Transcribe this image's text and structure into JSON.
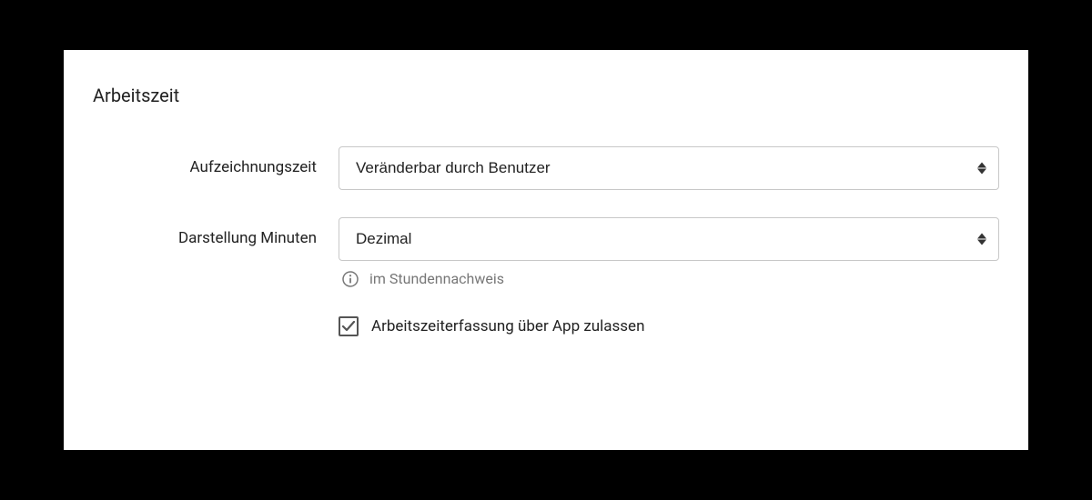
{
  "section": {
    "title": "Arbeitszeit"
  },
  "fields": {
    "recording_time": {
      "label": "Aufzeichnungszeit",
      "value": "Veränderbar durch Benutzer"
    },
    "minutes_display": {
      "label": "Darstellung Minuten",
      "value": "Dezimal",
      "hint": "im Stundennachweis"
    },
    "allow_app": {
      "label": "Arbeitszeiterfassung über App zulassen",
      "checked": true
    }
  }
}
